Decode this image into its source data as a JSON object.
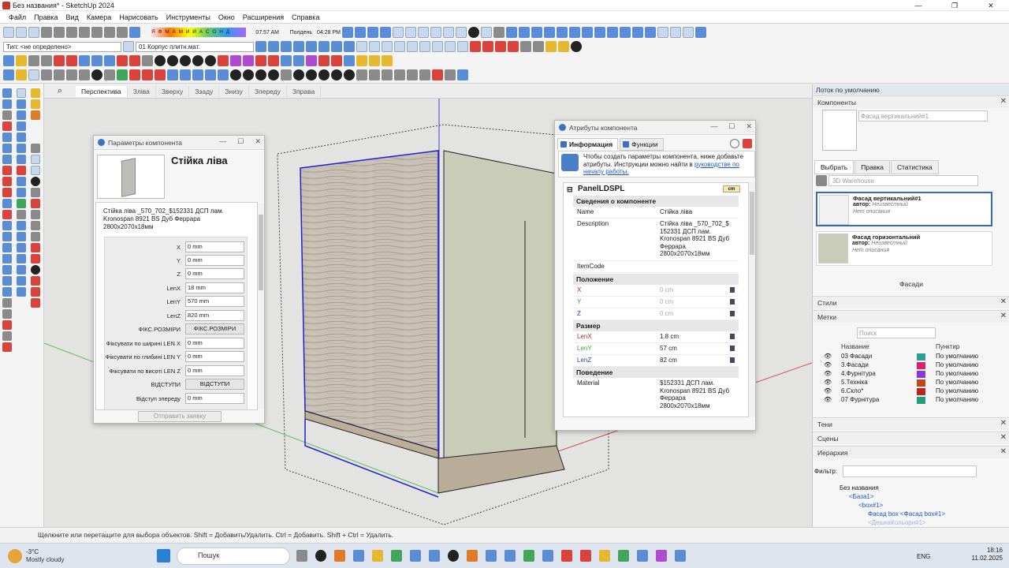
{
  "window": {
    "title": "Без названия* - SketchUp 2024"
  },
  "menu": [
    "Файл",
    "Правка",
    "Вид",
    "Камера",
    "Нарисовать",
    "Инструменты",
    "Окно",
    "Расширения",
    "Справка"
  ],
  "toolbar": {
    "type_label": "Тип: <не определено>",
    "material_label": "01 Корпус плитн.мат.",
    "shadow_letters": "Я Ф М А М И И А С О Н Д",
    "time_left": "07:57 AM",
    "time_mid": "Полдень",
    "time_right": "04:28 PM"
  },
  "scene_tabs": [
    "Перспектива",
    "Зліва",
    "Зверху",
    "Ззаду",
    "Знизу",
    "Зпереду",
    "Зправа"
  ],
  "component_params": {
    "title": "Параметры компонента",
    "name": "Стійка ліва",
    "description": "Стійка ліва _570_702_$152331 ДСП лам. Kronospan 8921 BS Дуб Феррара 2800x2070x18мм",
    "fields": [
      {
        "label": "X",
        "value": "0 mm"
      },
      {
        "label": "Y",
        "value": "0 mm"
      },
      {
        "label": "Z",
        "value": "0 mm"
      },
      {
        "label": "LenX",
        "value": "18 mm"
      },
      {
        "label": "LenY",
        "value": "570 mm"
      },
      {
        "label": "LenZ",
        "value": "820 mm"
      },
      {
        "label": "ФІКС.РОЗМІРИ",
        "button": "ФІКС.РОЗМІРИ"
      },
      {
        "label": "Фіксувати по ширині LEN X",
        "value": "0 mm"
      },
      {
        "label": "Фіксувати по глибині LEN Y",
        "value": "0 mm"
      },
      {
        "label": "Фіксувати по висоті LEN Z",
        "value": "0 mm"
      },
      {
        "label": "ВІДСТУПИ",
        "button": "ВІДСТУПИ"
      },
      {
        "label": "Відступ зпереду",
        "value": "0 mm"
      }
    ],
    "send_button": "Отправить заявку"
  },
  "component_attrs": {
    "title": "Атрибуты компонента",
    "tab_info": "Информация",
    "tab_functions": "Функции",
    "info_text": "Чтобы создать параметры компонента, ниже добавьте атрибуты. Инструкции можно найти в",
    "info_link": "руководстве по началу работы.",
    "panel_name": "PanelLDSPL",
    "panel_tag": "cm",
    "sections": {
      "info": "Сведения о компоненте",
      "position": "Положение",
      "size": "Размер",
      "behavior": "Поведение"
    },
    "name_label": "Name",
    "name_value": "Стійка ліва",
    "desc_label": "Description",
    "desc_value": "Стійка ліва _570_702_$ 152331 ДСП лам. Kronospan 8921 BS Дуб Феррара 2800x2070x18мм",
    "itemcode_label": "ItemCode",
    "x_label": "X",
    "x_value": "0 cm",
    "y_label": "Y",
    "y_value": "0 cm",
    "z_label": "Z",
    "z_value": "0 cm",
    "lenx_label": "LenX",
    "lenx_value": "1.8 cm",
    "leny_label": "LenY",
    "leny_value": "57 cm",
    "lenz_label": "LenZ",
    "lenz_value": "82 cm",
    "material_label": "Material",
    "material_value": "$152331 ДСП лам. Kronospan 8921 BS Дуб Феррара 2800x2070x18мм"
  },
  "tray": {
    "title": "Лоток по умолчанию",
    "components": "Компоненты",
    "comp_name": "Фасад вертикальний#1",
    "tabs": [
      "Выбрать",
      "Правка",
      "Статистика"
    ],
    "warehouse_placeholder": "3D Warehouse",
    "items": [
      {
        "name": "Фасад вертикальний#1",
        "author_label": "автор:",
        "author": "Неизвестный",
        "desc": "Нет описания"
      },
      {
        "name": "Фасад горизонтальний",
        "author_label": "автор:",
        "author": "Неизвестный",
        "desc": "Нет описания"
      }
    ],
    "collection": "Фасади",
    "styles": "Стили",
    "tags": "Метки",
    "search_placeholder": "Поиск",
    "col_name": "Название",
    "col_dash": "Пунктир",
    "layers": [
      {
        "name": "03 Фасади",
        "color": "#2aa198",
        "dash": "По умолчанию"
      },
      {
        "name": "3.Фасади",
        "color": "#d6246e",
        "dash": "По умолчанию"
      },
      {
        "name": "4.Фурнітура",
        "color": "#8a38d6",
        "dash": "По умолчанию"
      },
      {
        "name": "5.Техніка",
        "color": "#c2461f",
        "dash": "По умолчанию"
      },
      {
        "name": "6.Скло*",
        "color": "#b8261e",
        "dash": "По умолчанию"
      },
      {
        "name": "07 Фурнітура",
        "color": "#21a07c",
        "dash": "По умолчанию"
      }
    ],
    "shadows": "Тени",
    "scenes": "Сцены",
    "hierarchy": "Иерархия",
    "filter_label": "Фильтр:",
    "tree": {
      "root": "Без названия",
      "n1": "<База1>",
      "n2": "<box#1>",
      "n3": "Фасад box <Фасад box#1>",
      "n4": "<ДешкаКольори#1>"
    }
  },
  "status": {
    "text": "Щелкните или перетащите для выбора объектов. Shift = Добавить/Удалить. Ctrl = Добавить. Shift + Ctrl = Удалить."
  },
  "taskbar": {
    "temp": "-3°C",
    "weather": "Mostly cloudy",
    "search": "Пошук",
    "lang": "ENG",
    "time": "18:16",
    "date": "11.02.2025"
  }
}
